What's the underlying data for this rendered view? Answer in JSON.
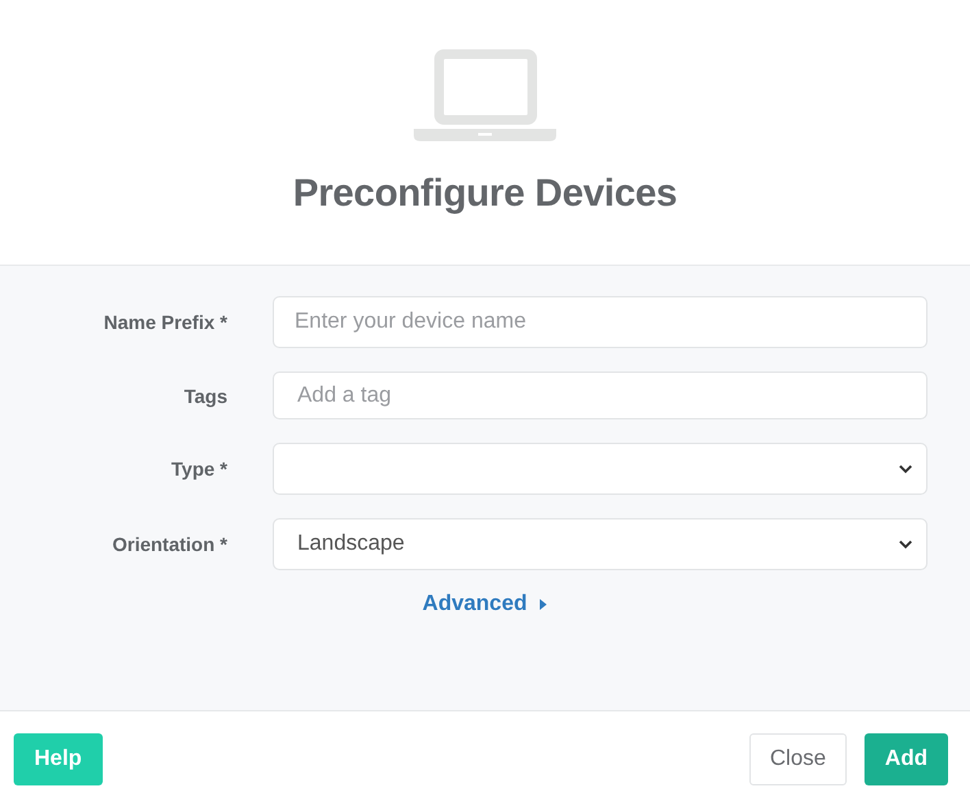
{
  "title": "Preconfigure Devices",
  "fields": [
    {
      "kind": "text",
      "label": "Name Prefix *",
      "placeholder": "Enter your device name"
    },
    {
      "kind": "tags",
      "label": "Tags",
      "placeholder": "Add a tag"
    },
    {
      "kind": "select",
      "label": "Type *"
    },
    {
      "kind": "select",
      "label": "Orientation *",
      "value": "Landscape"
    }
  ],
  "advanced": {
    "label": "Advanced",
    "expanded": false
  },
  "buttons": [
    {
      "kind": "help",
      "label": "Help"
    },
    {
      "kind": "close",
      "label": "Close"
    },
    {
      "kind": "add",
      "label": "Add"
    }
  ]
}
